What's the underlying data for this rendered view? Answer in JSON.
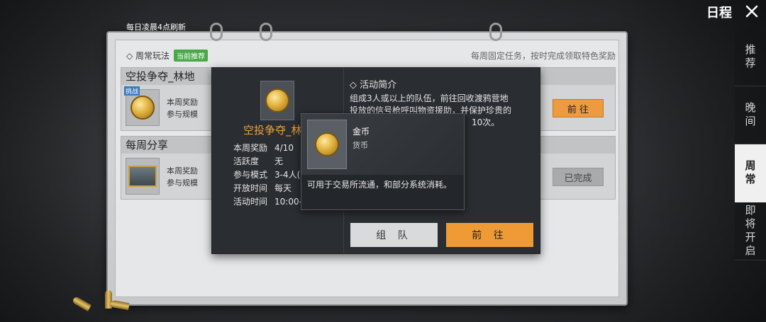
{
  "header": {
    "title": "日程",
    "close_icon": "close-icon"
  },
  "sidebar": {
    "tabs": [
      {
        "label": "推荐",
        "active": false
      },
      {
        "label": "晚间",
        "active": false
      },
      {
        "label": "周常",
        "active": true
      },
      {
        "label": "即将开启",
        "active": false
      }
    ]
  },
  "board": {
    "refresh_note": "每日凌晨4点刷新",
    "section_title": "◇ 周常玩法",
    "section_badge": "当前推荐",
    "weekly_note": "每周固定任务，按时完成领取特色奖励",
    "tasks": [
      {
        "title": "空投争夺_林地",
        "tag": "挑战",
        "meta1": "本周奖励",
        "meta2": "参与规模",
        "button": "前 往"
      },
      {
        "title": "每周分享",
        "meta1": "本周奖励",
        "meta2": "参与规模",
        "button": "已完成"
      }
    ]
  },
  "detail": {
    "name": "空投争夺_林",
    "rows": [
      {
        "k": "本周奖励",
        "v": "4/10"
      },
      {
        "k": "活跃度",
        "v": "无"
      },
      {
        "k": "参与模式",
        "v": "3-4人("
      },
      {
        "k": "开放时间",
        "v": "每天"
      },
      {
        "k": "活动时间",
        "v": "10:00-"
      }
    ],
    "intro_title": "◇ 活动简介",
    "intro_text1": "组成3人或以上的队伍，前往回收渡鸦营地",
    "intro_text2": "投放的信号枪呼叫物资援助，并保护珍贵的",
    "intro_text3": "10次。",
    "team_button": "组 队",
    "go_button": "前 往"
  },
  "tooltip": {
    "name": "金币",
    "type": "货币",
    "desc": "可用于交易所流通，和部分系统消耗。"
  }
}
